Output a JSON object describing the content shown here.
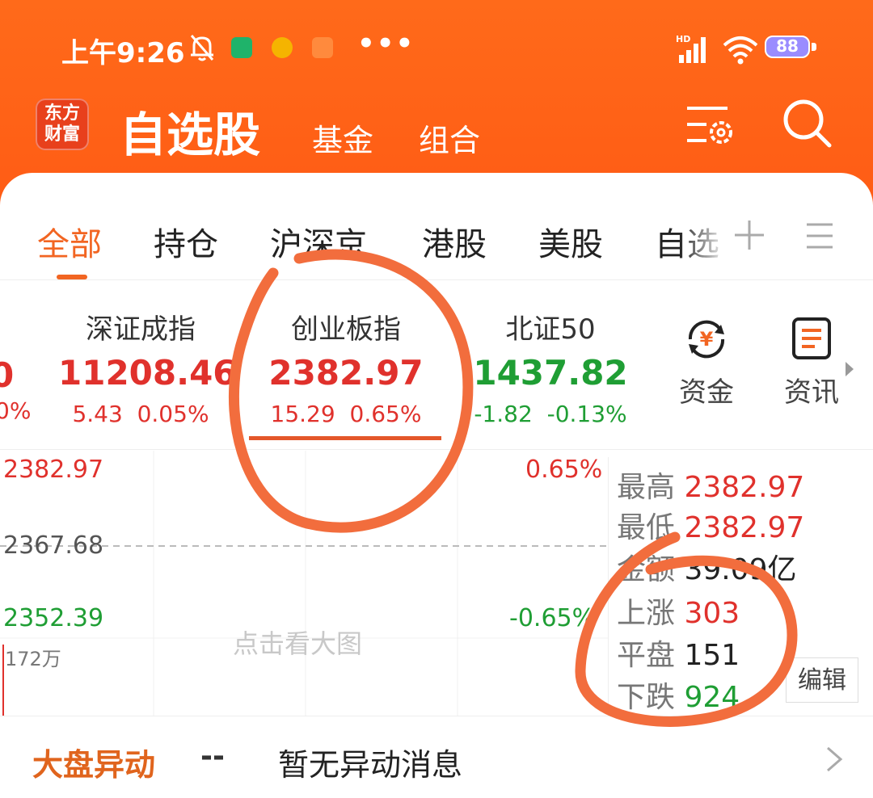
{
  "status_bar": {
    "time": "上午9:26",
    "battery": "88"
  },
  "header": {
    "logo_text": "东方财富",
    "title": "自选股",
    "nav_fund": "基金",
    "nav_portfolio": "组合"
  },
  "tabs": [
    "全部",
    "持仓",
    "沪深京",
    "港股",
    "美股",
    "自选"
  ],
  "indices": [
    {
      "name": "深证成指",
      "price": "11208.46",
      "change": "5.43",
      "pct": "0.05%",
      "trend": "up"
    },
    {
      "name": "创业板指",
      "price": "2382.97",
      "change": "15.29",
      "pct": "0.65%",
      "trend": "up"
    },
    {
      "name": "北证50",
      "price": "1437.82",
      "change": "-1.82",
      "pct": "-0.13%",
      "trend": "down"
    }
  ],
  "partial_left": {
    "price": "0",
    "pct": "0%"
  },
  "quick_actions": {
    "funds": "资金",
    "news": "资讯"
  },
  "mini_chart": {
    "high": "2382.97",
    "high_pct": "0.65%",
    "prev_close": "2367.68",
    "low": "2352.39",
    "low_pct": "-0.65%",
    "volume": "172万",
    "hint": "点击看大图"
  },
  "stats": {
    "high_label": "最高",
    "high_value": "2382.97",
    "low_label": "最低",
    "low_value": "2382.97",
    "amount_label": "金额",
    "amount_value": "39.09亿",
    "up_label": "上涨",
    "up_value": "303",
    "flat_label": "平盘",
    "flat_value": "151",
    "down_label": "下跌",
    "down_value": "924",
    "edit": "编辑"
  },
  "alert": {
    "label": "大盘异动",
    "dash": "--",
    "message": "暂无异动消息"
  },
  "colors": {
    "brand": "#ff6a1a",
    "up": "#e0312c",
    "down": "#1f9e34",
    "active_tab": "#f26522",
    "annotation": "#f26d3d"
  }
}
